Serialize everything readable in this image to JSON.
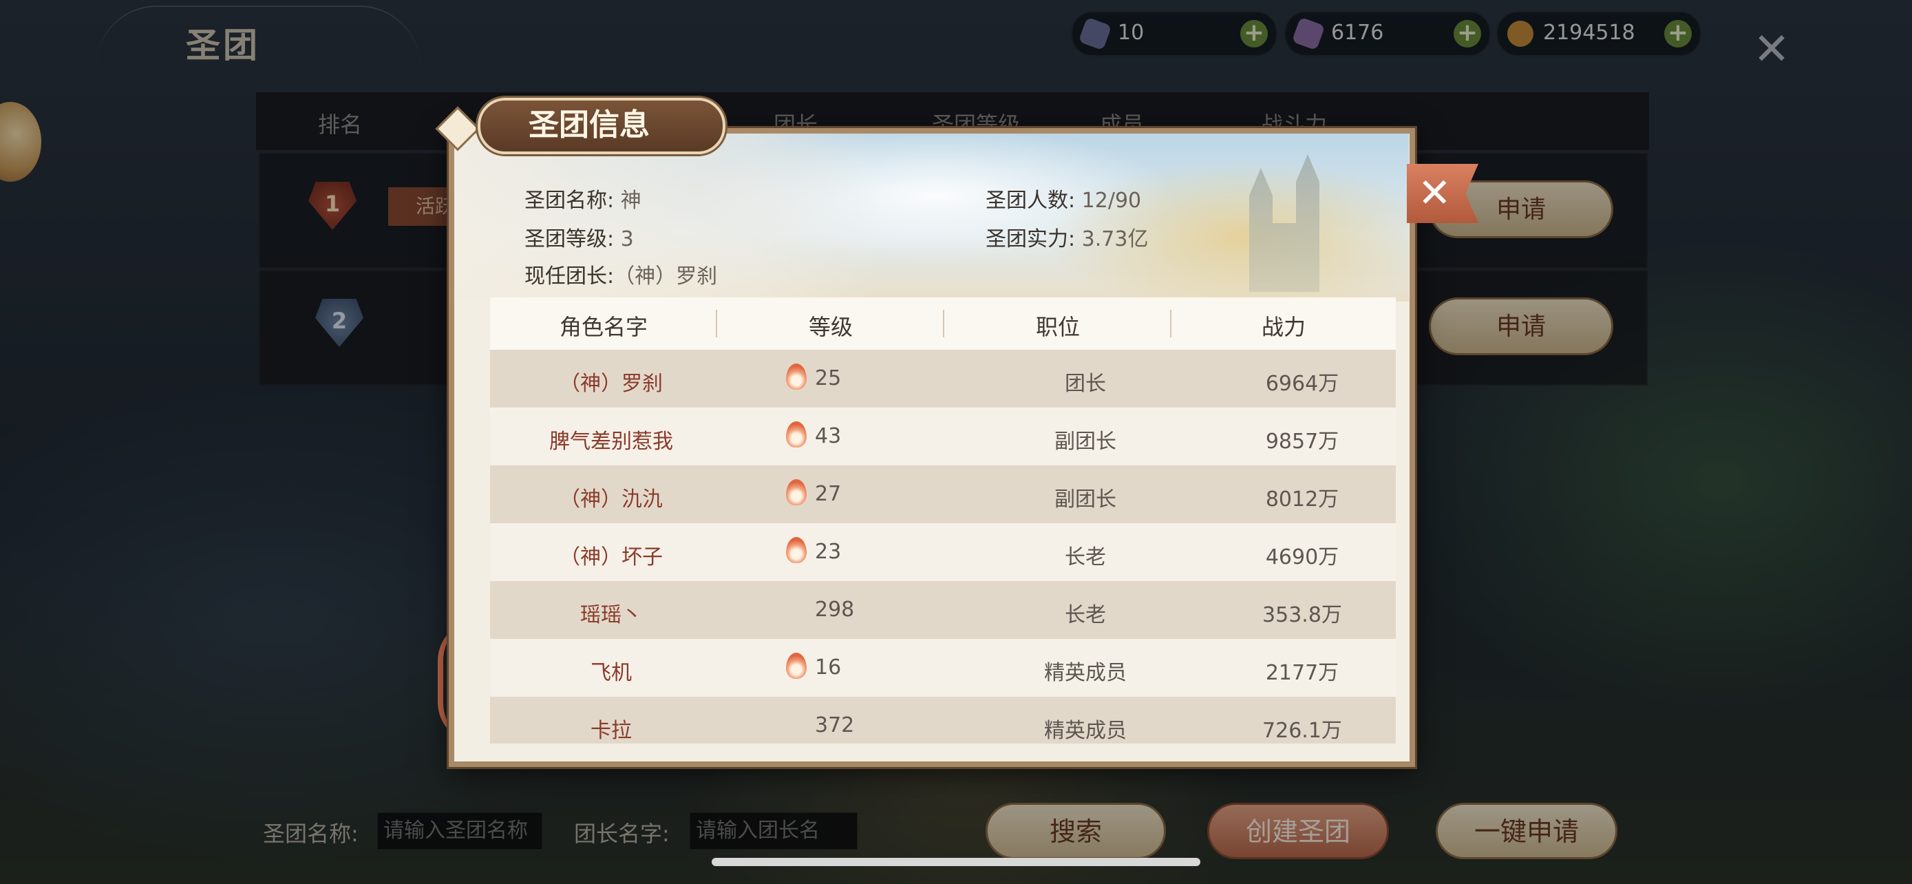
{
  "page": {
    "title": "圣团"
  },
  "currencies": [
    {
      "name": "crystal",
      "value": "10",
      "color": "#6b6f9a"
    },
    {
      "name": "gem",
      "value": "6176",
      "color": "#8e6ea6"
    },
    {
      "name": "gold",
      "value": "2194518",
      "color": "#c48a3a"
    }
  ],
  "list_header": {
    "rank": "排名",
    "leader": "团长",
    "level": "圣团等级",
    "members": "成员",
    "power": "战斗力"
  },
  "list_rows": [
    {
      "rank": "1",
      "tag": "活跃",
      "apply": "申请"
    },
    {
      "rank": "2",
      "apply": "申请"
    }
  ],
  "modal": {
    "title": "圣团信息",
    "info": {
      "name_label": "圣团名称:",
      "name": "神",
      "level_label": "圣团等级:",
      "level": "3",
      "leader_label": "现任团长:",
      "leader": "（神）罗刹",
      "members_label": "圣团人数:",
      "members": "12/90",
      "power_label": "圣团实力:",
      "power": "3.73亿"
    },
    "columns": [
      "角色名字",
      "等级",
      "职位",
      "战力"
    ],
    "members": [
      {
        "name": "（神）罗刹",
        "level": "25",
        "flame": true,
        "position": "团长",
        "power": "6964万"
      },
      {
        "name": "脾气差别惹我",
        "level": "43",
        "flame": true,
        "position": "副团长",
        "power": "9857万"
      },
      {
        "name": "（神）氿氿",
        "level": "27",
        "flame": true,
        "position": "副团长",
        "power": "8012万"
      },
      {
        "name": "（神）坏子",
        "level": "23",
        "flame": true,
        "position": "长老",
        "power": "4690万"
      },
      {
        "name": "瑶瑶丶",
        "level": "298",
        "flame": false,
        "position": "长老",
        "power": "353.8万"
      },
      {
        "name": "飞机",
        "level": "16",
        "flame": true,
        "position": "精英成员",
        "power": "2177万"
      },
      {
        "name": "卡拉",
        "level": "372",
        "flame": false,
        "position": "精英成员",
        "power": "726.1万"
      }
    ]
  },
  "bottom": {
    "guild_name_label": "圣团名称:",
    "guild_name_placeholder": "请输入圣团名称",
    "leader_name_label": "团长名字:",
    "leader_name_placeholder": "请输入团长名",
    "search": "搜索",
    "create": "创建圣团",
    "one_click_apply": "一键申请"
  }
}
